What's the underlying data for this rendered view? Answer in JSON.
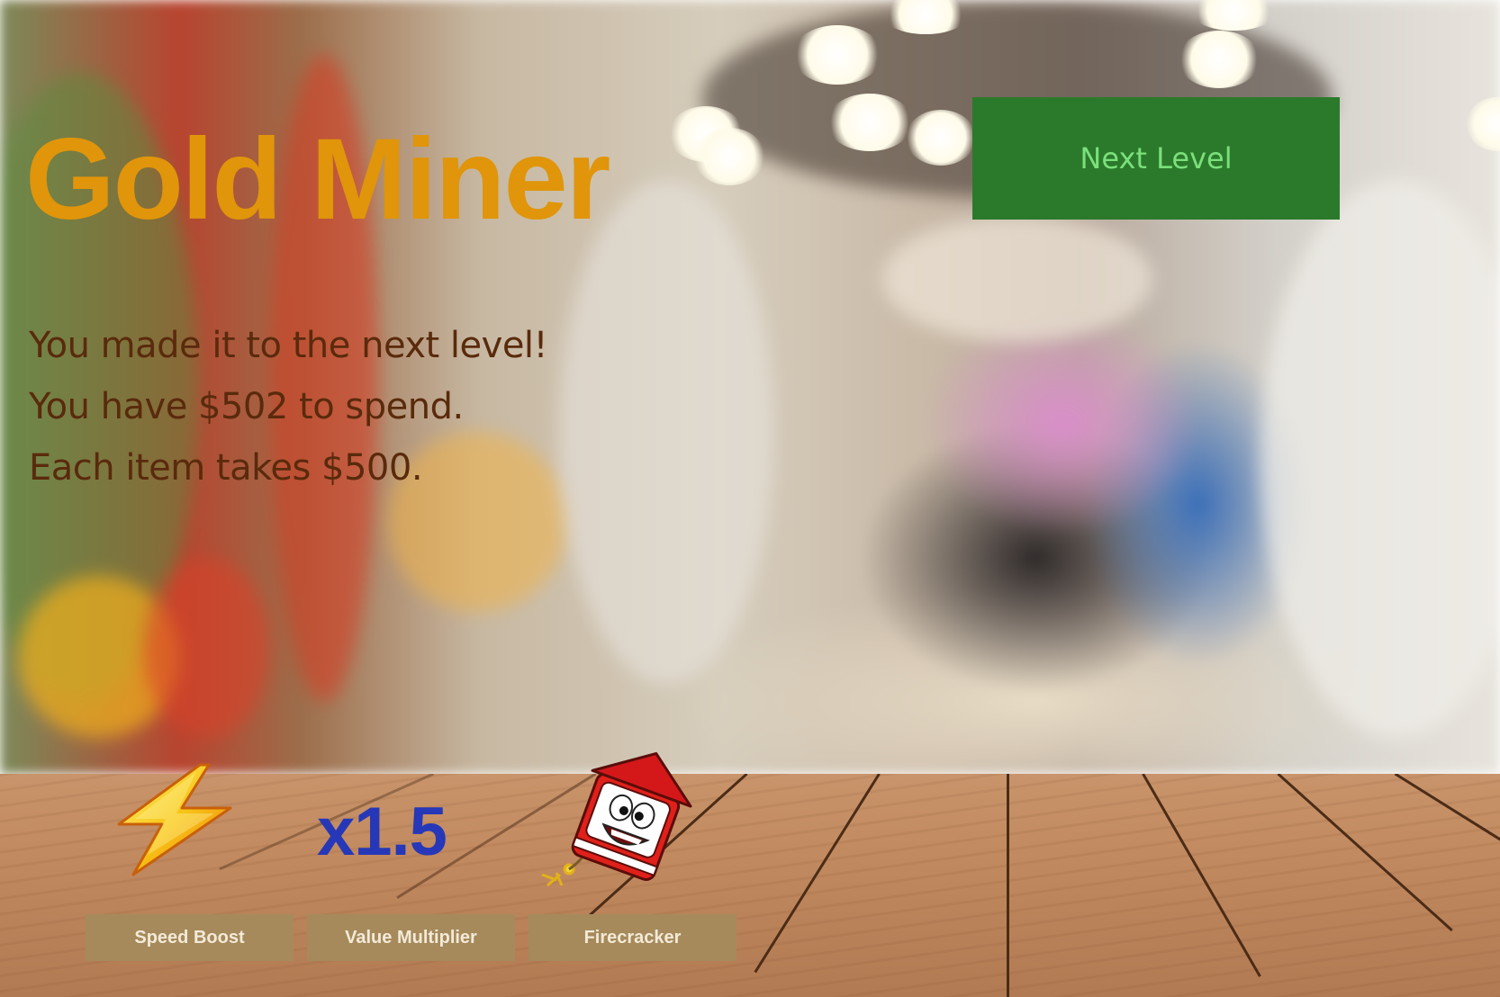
{
  "game": {
    "title": "Gold Miner",
    "next_level_label": "Next Level"
  },
  "message": {
    "line1": "You made it to the next level!",
    "line2": "You have $502 to spend.",
    "line3": "Each item takes $500."
  },
  "shop": {
    "items": [
      {
        "label": "Speed Boost",
        "icon": "lightning-bolt-icon"
      },
      {
        "label": "Value Multiplier",
        "icon": "multiplier-text-icon",
        "icon_text": "x1.5"
      },
      {
        "label": "Firecracker",
        "icon": "firecracker-icon"
      }
    ]
  },
  "colors": {
    "title": "#e0950a",
    "message_text": "#5a2a0c",
    "next_button_bg": "#2b7a2b",
    "next_button_text": "#7be07b",
    "item_button_bg": "#a68a5b",
    "item_button_text": "#f3ead8",
    "multiplier_text": "#2638b8"
  }
}
